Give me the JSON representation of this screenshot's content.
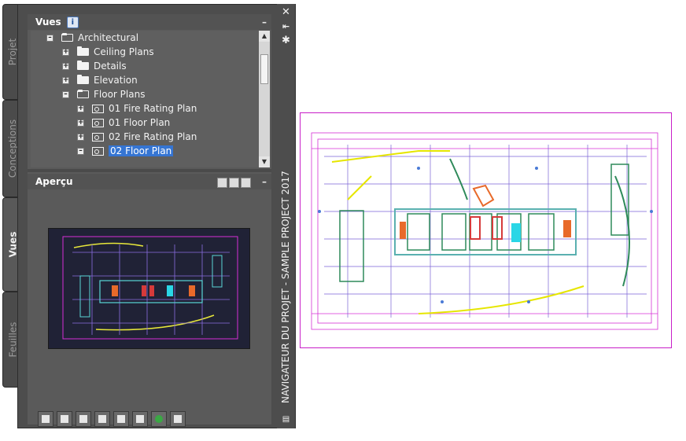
{
  "tabs": [
    "Projet",
    "Conceptions",
    "Vues",
    "Feuilles"
  ],
  "active_tab": "Vues",
  "views_panel": {
    "title": "Vues",
    "info_icon": "info-icon",
    "collapse_label": "–"
  },
  "tree": [
    {
      "label": "Architectural",
      "level": 0,
      "expander": "–",
      "icon": "folder-open-icon"
    },
    {
      "label": "Ceiling Plans",
      "level": 1,
      "expander": "+",
      "icon": "folder-icon"
    },
    {
      "label": "Details",
      "level": 1,
      "expander": "+",
      "icon": "folder-icon"
    },
    {
      "label": "Elevation",
      "level": 1,
      "expander": "+",
      "icon": "folder-icon"
    },
    {
      "label": "Floor Plans",
      "level": 1,
      "expander": "–",
      "icon": "folder-open-icon"
    },
    {
      "label": "01 Fire Rating Plan",
      "level": 2,
      "expander": "+",
      "icon": "view-icon"
    },
    {
      "label": "01 Floor Plan",
      "level": 2,
      "expander": "+",
      "icon": "view-icon"
    },
    {
      "label": "02 Fire Rating Plan",
      "level": 2,
      "expander": "+",
      "icon": "view-icon"
    },
    {
      "label": "02 Floor Plan",
      "level": 2,
      "expander": "–",
      "icon": "view-icon",
      "selected": true
    }
  ],
  "preview_panel": {
    "title": "Aperçu",
    "collapse_label": "–"
  },
  "toolbar": [
    "new-view-icon",
    "new-view-category-icon",
    "open-view-icon",
    "delete-icon",
    "select-icon",
    "properties-icon",
    "refresh-icon",
    "cleanup-icon"
  ],
  "navigator_title": "NAVIGATEUR DU PROJET - SAMPLE PROJECT 2017",
  "window_controls": [
    "close-icon",
    "auto-hide-icon",
    "settings-icon"
  ],
  "colors": {
    "selection": "#3575d3",
    "drawing_border": "#c81ec8",
    "preview_bg": "#202236"
  }
}
